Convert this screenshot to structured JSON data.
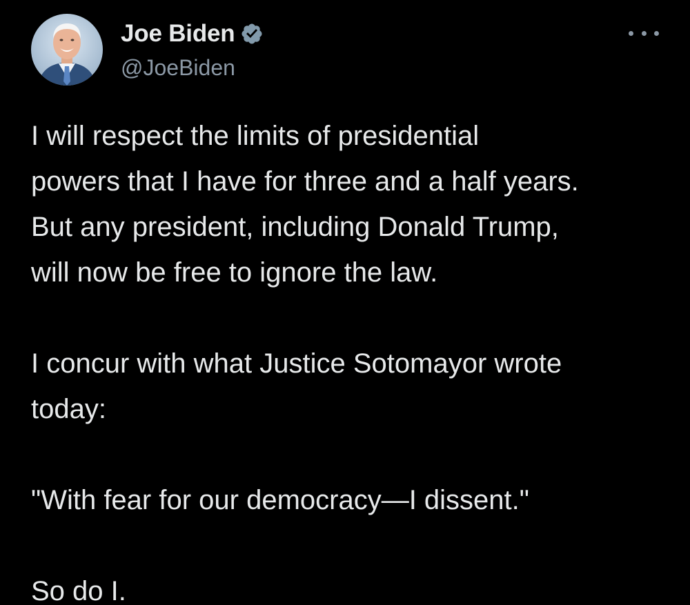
{
  "author": {
    "display_name": "Joe Biden",
    "handle": "@JoeBiden",
    "verified_icon": "verified-badge-icon",
    "avatar_icon": "avatar-photo"
  },
  "menu": {
    "icon": "more-options-icon"
  },
  "tweet": {
    "paragraphs": [
      "I will respect the limits of presidential\npowers that I have for three and a half years.\nBut any president, including Donald Trump,\nwill now be free to ignore the law.",
      "I concur with what Justice Sotomayor wrote\ntoday:",
      "\"With fear for our democracy—I dissent.\"",
      "So do I."
    ]
  },
  "colors": {
    "background": "#000000",
    "text": "#e7e9ea",
    "secondary": "#8b98a5",
    "verified_badge": "#829aab"
  }
}
